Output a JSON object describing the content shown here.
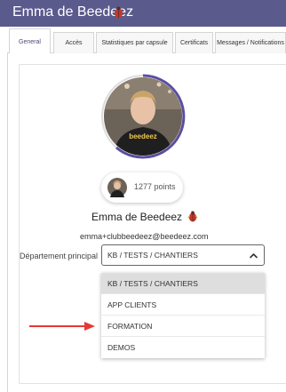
{
  "window": {
    "title": "Emma de Beedeez",
    "title_icon": "beetle-icon"
  },
  "tabs": [
    {
      "label": "General",
      "active": true
    },
    {
      "label": "Accès",
      "active": false
    },
    {
      "label": "Statistiques par capsule",
      "active": false
    },
    {
      "label": "Certificats",
      "active": false
    },
    {
      "label": "Messages / Notifications",
      "active": false
    }
  ],
  "profile": {
    "points": "1277 points",
    "name": "Emma de Beedeez",
    "email": "emma+clubbeedeez@beedeez.com",
    "shirt_text": "beedeez"
  },
  "department": {
    "label": "Département principal",
    "selected": "KB / TESTS / CHANTIERS",
    "options": [
      "KB / TESTS / CHANTIERS",
      "APP CLIENTS",
      "FORMATION",
      "DEMOS"
    ]
  },
  "colors": {
    "titlebar": "#5b5a8c",
    "progress_ring": "#5b4fa0",
    "arrow": "#e53935"
  }
}
